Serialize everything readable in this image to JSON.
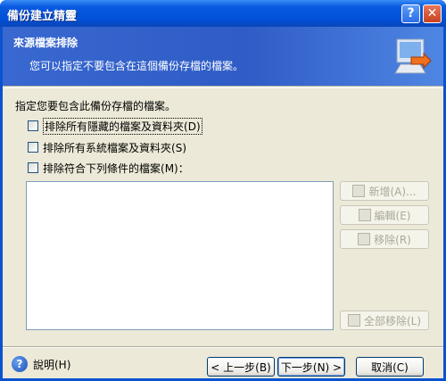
{
  "window": {
    "title": "備份建立精靈"
  },
  "header": {
    "title": "來源檔案排除",
    "subtitle": "您可以指定不要包含在這個備份存檔的檔案。"
  },
  "main": {
    "prompt": "指定您要包含此備份存檔的檔案。",
    "options": [
      {
        "label": "排除所有隱藏的檔案及資料夾",
        "mnemonic": "(D)",
        "checked": false
      },
      {
        "label": "排除所有系統檔案及資料夾",
        "mnemonic": "(S)",
        "checked": false
      },
      {
        "label": "排除符合下列條件的檔案",
        "mnemonic": "(M)",
        "suffix": "：",
        "checked": false
      }
    ],
    "buttons": {
      "add": "新增(A)...",
      "edit": "編輯(E)",
      "remove": "移除(R)",
      "remove_all": "全部移除(L)"
    }
  },
  "footer": {
    "help": "說明(H)",
    "back": "< 上一步(B)",
    "next": "下一步(N) >",
    "cancel": "取消(C)"
  },
  "colors": {
    "titlebar": "#0a5ae0",
    "header": "#3868d0",
    "client": "#ece9d8"
  }
}
